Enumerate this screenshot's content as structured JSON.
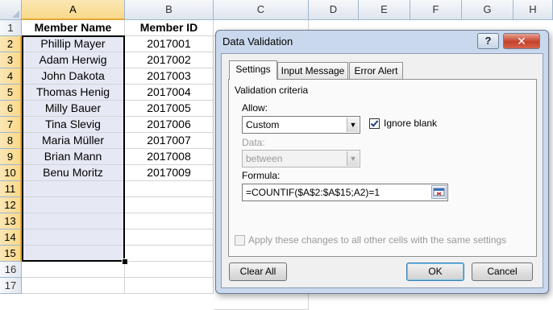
{
  "sheet": {
    "columns": [
      "A",
      "B",
      "C",
      "D",
      "E",
      "F",
      "G",
      "H"
    ],
    "rows": [
      "1",
      "2",
      "3",
      "4",
      "5",
      "6",
      "7",
      "8",
      "9",
      "10",
      "11",
      "12",
      "13",
      "14",
      "15",
      "16",
      "17"
    ],
    "header": {
      "name": "Member Name",
      "id": "Member ID"
    },
    "members": [
      {
        "name": "Phillip Mayer",
        "id": "2017001"
      },
      {
        "name": "Adam Herwig",
        "id": "2017002"
      },
      {
        "name": "John Dakota",
        "id": "2017003"
      },
      {
        "name": "Thomas Henig",
        "id": "2017004"
      },
      {
        "name": "Milly Bauer",
        "id": "2017005"
      },
      {
        "name": "Tina Slevig",
        "id": "2017006"
      },
      {
        "name": "Maria Müller",
        "id": "2017007"
      },
      {
        "name": "Brian Mann",
        "id": "2017008"
      },
      {
        "name": "Benu Moritz",
        "id": "2017009"
      }
    ],
    "selection_fill_color": "#e6e9f4"
  },
  "dialog": {
    "title": "Data Validation",
    "help_label": "?",
    "close_label": "✕",
    "tabs": [
      "Settings",
      "Input Message",
      "Error Alert"
    ],
    "active_tab": "Settings",
    "section_label": "Validation criteria",
    "allow_label": "Allow:",
    "allow_value": "Custom",
    "ignore_blank_label": "Ignore blank",
    "ignore_blank_checked": true,
    "data_label": "Data:",
    "data_value": "between",
    "formula_label": "Formula:",
    "formula_value": "=COUNTIF($A$2:$A$15;A2)=1",
    "apply_label": "Apply these changes to all other cells with the same settings",
    "clear_all_label": "Clear All",
    "ok_label": "OK",
    "cancel_label": "Cancel"
  },
  "icons": {
    "dropdown": "chevron-down-icon",
    "collapse": "collapse-dialog-icon",
    "check": "checkmark-icon"
  }
}
